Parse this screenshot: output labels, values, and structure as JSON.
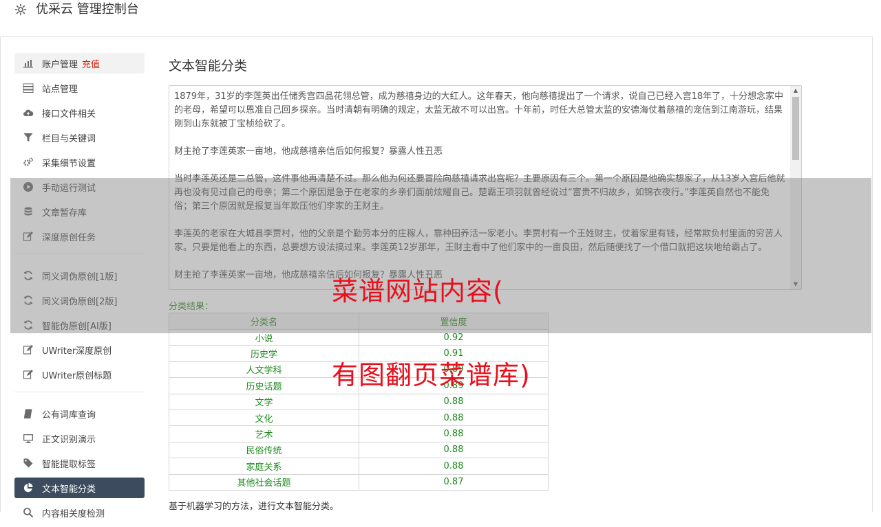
{
  "header": {
    "title": "优采云 管理控制台",
    "icon": "gear-icon"
  },
  "sidebar": {
    "groups": [
      [
        {
          "label": "账户管理",
          "badge": "充值",
          "icon": "bar-chart-icon",
          "state": "highlight"
        },
        {
          "label": "站点管理",
          "icon": "server-icon"
        },
        {
          "label": "接口文件相关",
          "icon": "cloud-upload-icon"
        },
        {
          "label": "栏目与关键词",
          "icon": "filter-icon"
        },
        {
          "label": "采集细节设置",
          "icon": "cogs-icon"
        },
        {
          "label": "手动运行测试",
          "icon": "play-icon"
        },
        {
          "label": "文章暂存库",
          "icon": "database-icon"
        },
        {
          "label": "深度原创任务",
          "icon": "edit-icon"
        }
      ],
      [
        {
          "label": "同义词伪原创[1版]",
          "icon": "refresh-icon"
        },
        {
          "label": "同义词伪原创[2版]",
          "icon": "refresh-icon"
        },
        {
          "label": "智能伪原创[AI版]",
          "icon": "refresh-icon"
        },
        {
          "label": "UWriter深度原创",
          "icon": "edit-icon"
        },
        {
          "label": "UWriter原创标题",
          "icon": "edit-icon"
        }
      ],
      [
        {
          "label": "公有词库查询",
          "icon": "book-icon"
        },
        {
          "label": "正文识别演示",
          "icon": "monitor-icon"
        },
        {
          "label": "智能提取标签",
          "icon": "tag-icon"
        },
        {
          "label": "文本智能分类",
          "icon": "pie-chart-icon",
          "state": "active"
        },
        {
          "label": "内容相关度检测",
          "icon": "search-icon"
        }
      ]
    ]
  },
  "main": {
    "title": "文本智能分类",
    "text_paragraphs": [
      "1879年，31岁的李莲英出任储秀宫四品花翎总管，成为慈禧身边的大红人。这年春天，他向慈禧提出了一个请求，说自己已经入宫18年了，十分想念家中的老母，希望可以恩准自己回乡探亲。当时清朝有明确的规定，太监无故不可以出宫。十年前，时任大总管太监的安德海仗着慈禧的宠信到江南游玩，结果刚到山东就被丁宝桢给砍了。",
      "财主抢了李莲英家一亩地，他成慈禧亲信后如何报复？暴露人性丑恶",
      "当时李莲英还是二总管，这件事他再清楚不过。那么他为何还要冒险向慈禧请求出宫呢？主要原因有三个。第一个原因是他确实想家了，从13岁入宫后他就再也没有见过自己的母亲；第二个原因是急于在老家的乡亲们面前炫耀自己。楚霸王项羽就曾经说过“富贵不归故乡，如锦衣夜行。”李莲英自然也不能免俗；第三个原因就是报复当年欺压他们李家的王财主。",
      "李莲英的老家在大城县李贾村，他的父亲是个勤劳本分的庄稼人，靠种田养活一家老小。李贾村有一个王姓财主，仗着家里有钱，经常欺负村里面的穷苦人家。只要是他看上的东西，总要想方设法搞过来。李莲英12岁那年，王财主看中了他们家中的一亩良田，然后随便找了一个借口就把这块地给霸占了。",
      "财主抢了李莲英家一亩地，他成慈禧亲信后如何报复？暴露人性丑恶"
    ],
    "result_label": "分类结果：",
    "table_headers": [
      "分类名",
      "置信度"
    ],
    "table_rows": [
      [
        "小说",
        "0.92"
      ],
      [
        "历史学",
        "0.91"
      ],
      [
        "人文学科",
        "0.89"
      ],
      [
        "历史话题",
        "0.89"
      ],
      [
        "文学",
        "0.88"
      ],
      [
        "文化",
        "0.88"
      ],
      [
        "艺术",
        "0.88"
      ],
      [
        "民俗传统",
        "0.88"
      ],
      [
        "家庭关系",
        "0.88"
      ],
      [
        "其他社会话题",
        "0.87"
      ]
    ],
    "footnote": "基于机器学习的方法，进行文本智能分类。"
  },
  "watermark": {
    "line1": "菜谱网站内容(",
    "line2": "有图翻页菜谱库)"
  },
  "colors": {
    "active_bg": "#3c4b5e",
    "recharge": "#d9230f",
    "result_green": "#1a8a1a",
    "watermark": "#e8101c"
  }
}
